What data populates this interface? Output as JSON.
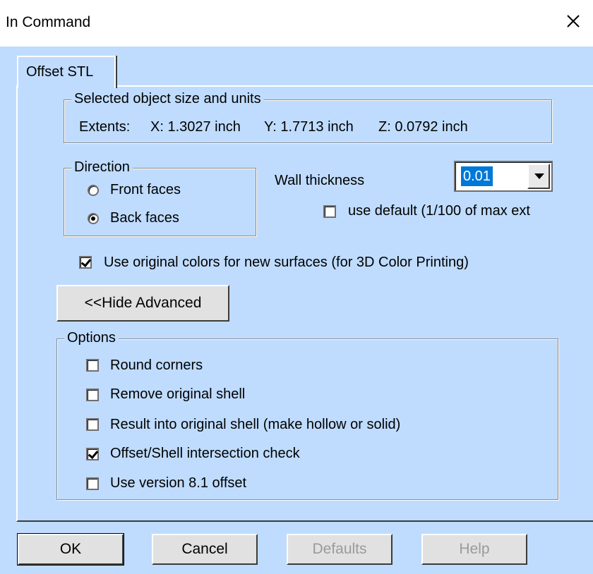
{
  "window": {
    "title": "In Command"
  },
  "tab": {
    "label": "Offset STL"
  },
  "object_size": {
    "legend": "Selected object size and units",
    "extents_label": "Extents:",
    "x": "X: 1.3027 inch",
    "y": "Y: 1.7713 inch",
    "z": "Z: 0.0792 inch"
  },
  "direction": {
    "legend": "Direction",
    "front_label": "Front faces",
    "back_label": "Back faces",
    "selected": "Back faces"
  },
  "wall": {
    "label": "Wall thickness",
    "value": "0.01",
    "use_default_label": "use default (1/100 of max ext",
    "use_default_checked": false
  },
  "original_colors": {
    "label": "Use original colors for new surfaces (for 3D Color Printing)",
    "checked": true
  },
  "advanced_button": "<<Hide Advanced",
  "options": {
    "legend": "Options",
    "items": [
      {
        "label": "Round corners",
        "checked": false
      },
      {
        "label": "Remove original shell",
        "checked": false
      },
      {
        "label": "Result into original shell (make hollow or solid)",
        "checked": false
      },
      {
        "label": "Offset/Shell intersection check",
        "checked": true
      },
      {
        "label": "Use version 8.1 offset",
        "checked": false
      }
    ]
  },
  "buttons": {
    "ok": "OK",
    "cancel": "Cancel",
    "defaults": "Defaults",
    "help": "Help"
  },
  "colors": {
    "background": "#bfdcff",
    "selection": "#0078d7",
    "disabled_text": "#9a9a9a"
  }
}
